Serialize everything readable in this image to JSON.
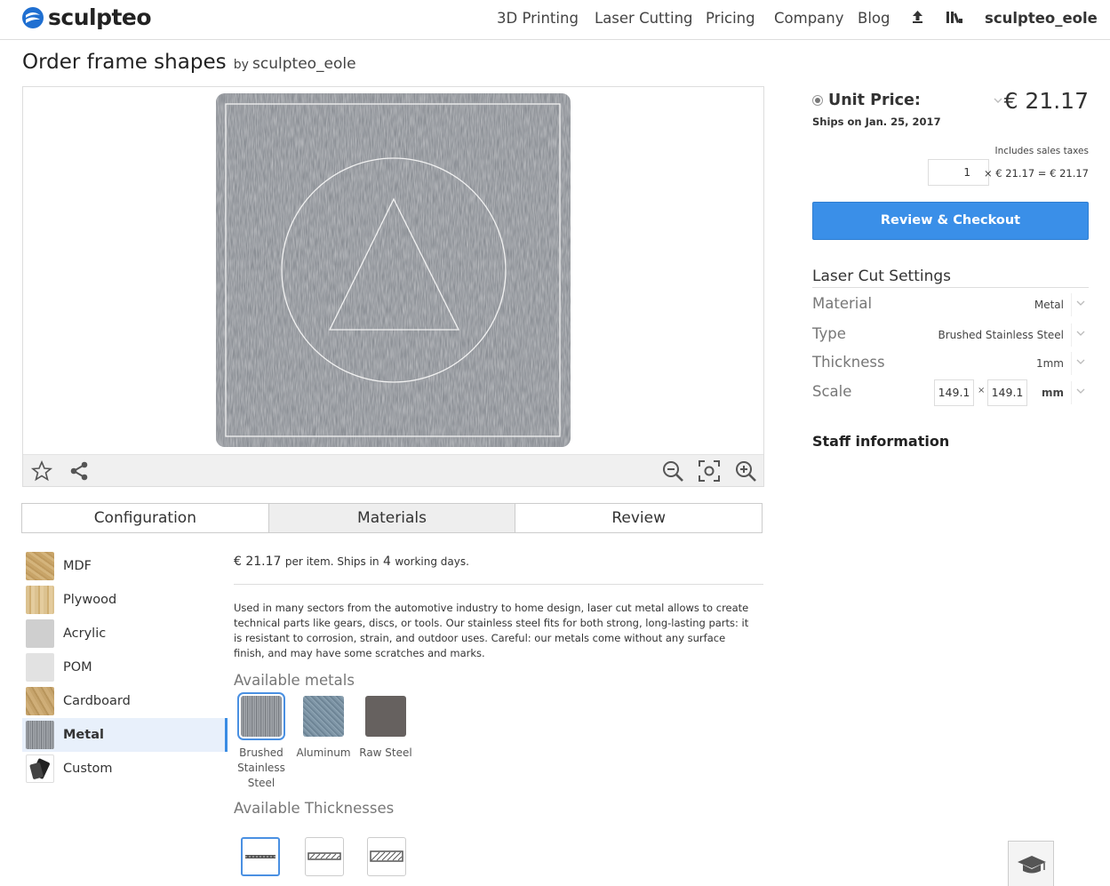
{
  "brand": {
    "name": "sculpteo",
    "accent": "#1f6fd1"
  },
  "nav": {
    "items": [
      "3D Printing",
      "Laser Cutting",
      "Pricing",
      "Company",
      "Blog"
    ],
    "upload_icon": "upload-icon",
    "library_icon": "library-icon",
    "user": "sculpteo_eole"
  },
  "page": {
    "title": "Order frame shapes",
    "by": "by",
    "owner": "sculpteo_eole"
  },
  "viewer": {
    "toolbar_left": [
      "star-icon",
      "share-icon"
    ],
    "toolbar_right": [
      "zoom-out-icon",
      "focus-icon",
      "zoom-in-icon"
    ]
  },
  "tabs": [
    {
      "label": "Configuration",
      "active": false
    },
    {
      "label": "Materials",
      "active": true
    },
    {
      "label": "Review",
      "active": false
    }
  ],
  "materials": [
    {
      "label": "MDF",
      "color": "#c9a56a"
    },
    {
      "label": "Plywood",
      "color": "#d8bd8a"
    },
    {
      "label": "Acrylic",
      "color": "#cfcfcf"
    },
    {
      "label": "POM",
      "color": "#e2e2e2"
    },
    {
      "label": "Cardboard",
      "color": "#c4a26a"
    },
    {
      "label": "Metal",
      "color": "#8c9096",
      "active": true
    },
    {
      "label": "Custom",
      "color": "#ffffff"
    }
  ],
  "detail": {
    "price": "€ 21.17",
    "per_item": "per item. Ships in",
    "days": "4",
    "working_days": "working days.",
    "description": "Used in many sectors from the automotive industry to home design, laser cut metal allows to create technical parts like gears, discs, or tools. Our stainless steel fits for both strong, long-lasting parts: it is resistant to corrosion, strain, and outdoor uses. Careful: our metals come without any surface finish, and may have some scratches and marks.",
    "available_metals_title": "Available metals",
    "metals": [
      {
        "line1": "Brushed",
        "line2": "Stainless",
        "line3": "Steel",
        "color": "#8a8f95",
        "active": true
      },
      {
        "line1": "Aluminum",
        "line2": "",
        "line3": "",
        "color": "#8197a8"
      },
      {
        "line1": "Raw Steel",
        "line2": "",
        "line3": "",
        "color": "#66615f"
      }
    ],
    "available_thicknesses_title": "Available Thicknesses"
  },
  "order": {
    "unit_price_label": "Unit Price:",
    "ships_on": "Ships on Jan. 25, 2017",
    "price": "€ 21.17",
    "includes_taxes": "Includes sales taxes",
    "quantity": "1",
    "calc": "× € 21.17 = € 21.17",
    "checkout_label": "Review & Checkout"
  },
  "settings": {
    "title": "Laser Cut Settings",
    "material_label": "Material",
    "material_value": "Metal",
    "type_label": "Type",
    "type_value": "Brushed Stainless Steel",
    "thickness_label": "Thickness",
    "thickness_value": "1mm",
    "scale_label": "Scale",
    "scale_x": "149.1",
    "scale_sep": "×",
    "scale_y": "149.1",
    "scale_unit": "mm"
  },
  "staff_title": "Staff information"
}
